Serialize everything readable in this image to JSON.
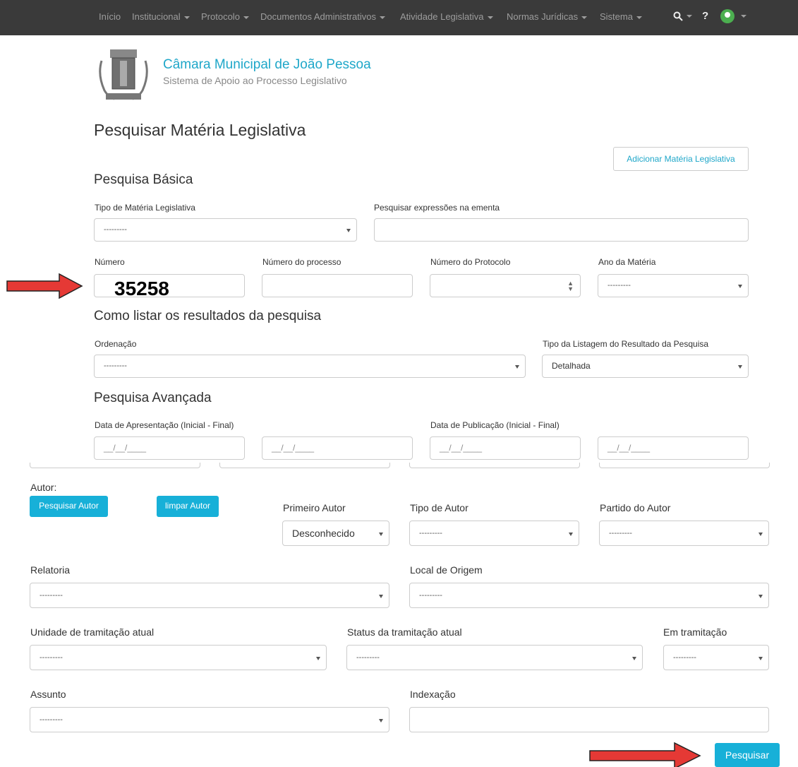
{
  "nav": {
    "items": [
      "Início",
      "Institucional",
      "Protocolo",
      "Documentos Administrativos",
      "Atividade Legislativa",
      "Normas Jurídicas",
      "Sistema"
    ],
    "help": "?"
  },
  "header": {
    "title": "Câmara Municipal de João Pessoa",
    "subtitle": "Sistema de Apoio ao Processo Legislativo"
  },
  "page": {
    "title": "Pesquisar Matéria Legislativa",
    "add_button": "Adicionar Matéria Legislativa"
  },
  "basic": {
    "heading": "Pesquisa Básica",
    "tipo_label": "Tipo de Matéria Legislativa",
    "tipo_value": "---------",
    "ementa_label": "Pesquisar expressões na ementa",
    "numero_label": "Número",
    "numero_annotation": "35258",
    "processo_label": "Número do processo",
    "protocolo_label": "Número do Protocolo",
    "ano_label": "Ano da Matéria",
    "ano_value": "---------"
  },
  "listing": {
    "heading": "Como listar os resultados da pesquisa",
    "ordenacao_label": "Ordenação",
    "ordenacao_value": "---------",
    "tipo_listagem_label": "Tipo da Listagem do Resultado da Pesquisa",
    "tipo_listagem_value": "Detalhada"
  },
  "advanced": {
    "heading": "Pesquisa Avançada",
    "apresentacao_label": "Data de Apresentação (Inicial - Final)",
    "publicacao_label": "Data de Publicação (Inicial - Final)",
    "date_placeholder": "__/__/____",
    "autor_label": "Autor:",
    "pesquisar_autor": "Pesquisar Autor",
    "limpar_autor": "limpar Autor",
    "primeiro_autor_label": "Primeiro Autor",
    "primeiro_autor_value": "Desconhecido",
    "tipo_autor_label": "Tipo de Autor",
    "tipo_autor_value": "---------",
    "partido_label": "Partido do Autor",
    "partido_value": "---------",
    "relatoria_label": "Relatoria",
    "relatoria_value": "---------",
    "local_label": "Local de Origem",
    "local_value": "---------",
    "unidade_label": "Unidade de tramitação atual",
    "unidade_value": "---------",
    "status_label": "Status da tramitação atual",
    "status_value": "---------",
    "em_tramitacao_label": "Em tramitação",
    "em_tramitacao_value": "---------",
    "assunto_label": "Assunto",
    "assunto_value": "---------",
    "indexacao_label": "Indexação",
    "search_button": "Pesquisar"
  },
  "colors": {
    "navbar": "#3a3a3a",
    "accent": "#17b0d8",
    "annotation_arrow": "#e53935"
  }
}
